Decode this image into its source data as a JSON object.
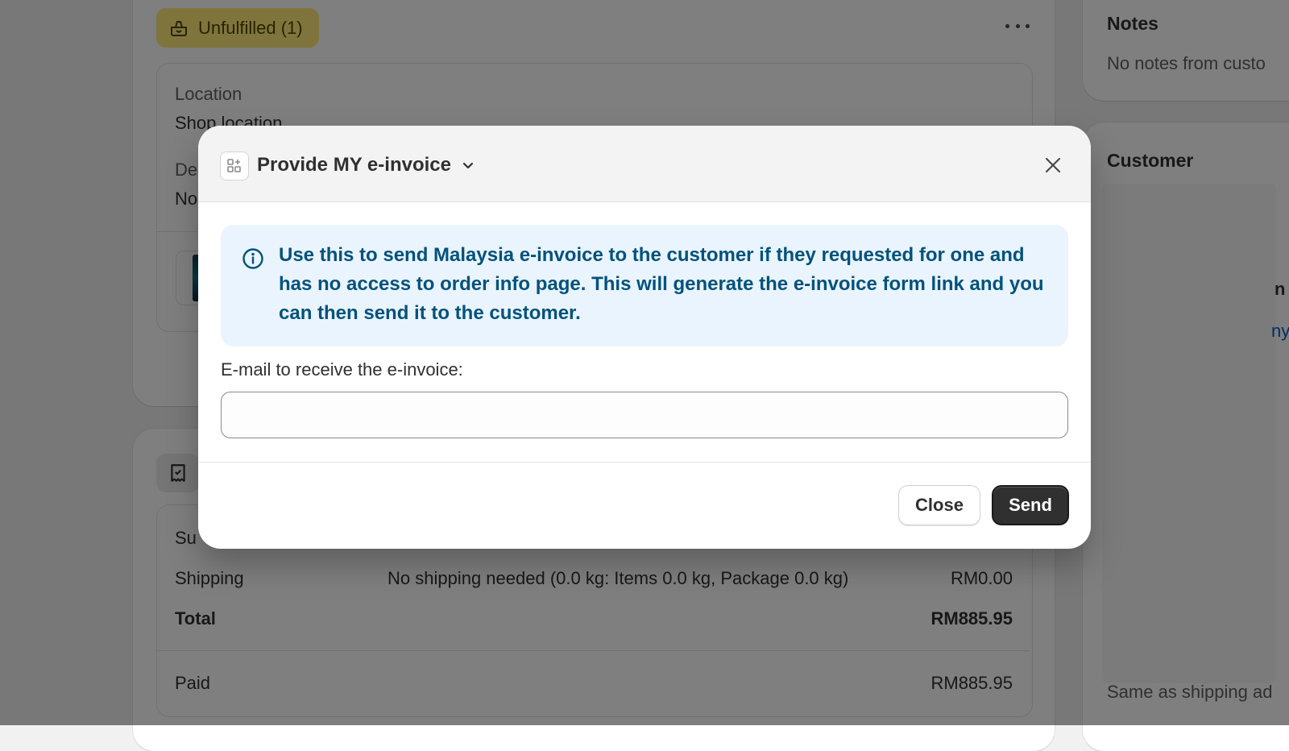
{
  "background": {
    "fulfillment": {
      "badge_label": "Unfulfilled (1)",
      "location_label": "Location",
      "location_value": "Shop location",
      "delivery_label": "De",
      "delivery_value": "No"
    },
    "payment": {
      "subtotal_label": "Su",
      "shipping_label": "Shipping",
      "shipping_desc": "No shipping needed (0.0 kg: Items 0.0 kg, Package 0.0 kg)",
      "shipping_value": "RM0.00",
      "total_label": "Total",
      "total_value": "RM885.95",
      "paid_label": "Paid",
      "paid_value": "RM885.95"
    },
    "notes": {
      "title": "Notes",
      "text": "No notes from custo"
    },
    "customer": {
      "title": "Customer",
      "fragment_n": "n",
      "fragment_link": "ny",
      "bottom_text": "Same as shipping ad"
    }
  },
  "modal": {
    "title": "Provide MY e-invoice",
    "info_text": "Use this to send Malaysia e-invoice to the customer if they requested for one and has no access to order info page. This will generate the e-invoice form link and you can then send it to the customer.",
    "email_label": "E-mail to receive the e-invoice:",
    "email_value": "",
    "close_label": "Close",
    "send_label": "Send"
  }
}
